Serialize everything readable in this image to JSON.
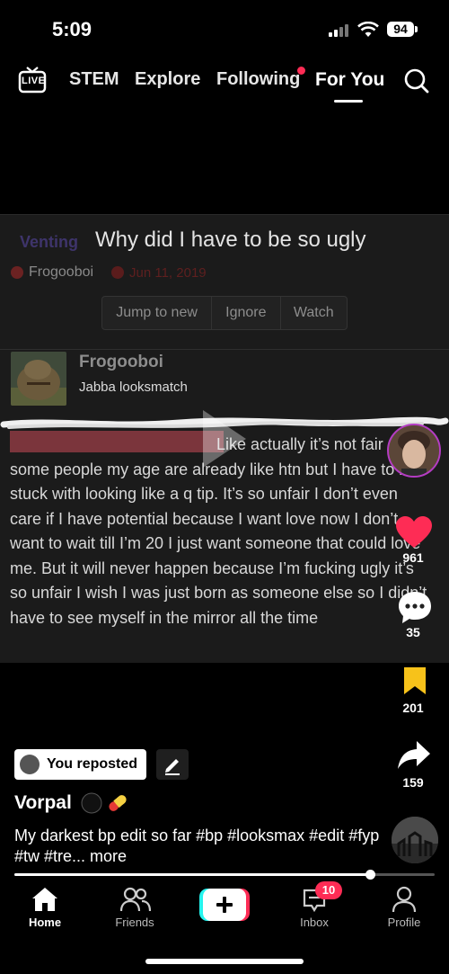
{
  "status_bar": {
    "time": "5:09",
    "battery": "94"
  },
  "top_nav": {
    "live_label": "LIVE",
    "tabs": [
      "STEM",
      "Explore",
      "Following",
      "For You"
    ],
    "active_tab": "For You"
  },
  "forum_post": {
    "category": "Venting",
    "thread_title": "Why did I have to be so ugly",
    "thread_author": "Frogooboi",
    "thread_date": "Jun 11, 2019",
    "buttons": [
      "Jump to new",
      "Ignore",
      "Watch"
    ],
    "post_author": "Frogooboi",
    "post_subtitle": "Jabba looksmatch",
    "body_first_line": "Like actually it’s not fair",
    "body_rest": "some people my age are already like htn but I have to be stuck with looking like a q tip. It’s so unfair I don’t even care if I have potential because I want love now I don’t want to wait till I’m 20 I just want someone that could love me. But it will never happen because I’m fucking ugly it’s so unfair I wish I was just born as someone else so I didn’t have to see myself in the mirror all the time"
  },
  "actions": {
    "likes": "961",
    "comments": "35",
    "saves": "201",
    "shares": "159"
  },
  "video_info": {
    "repost_label": "You reposted",
    "username": "Vorpal",
    "caption": "My darkest bp edit so far #bp #looksmax #edit #fyp #tw #tre... more",
    "progress": 0.846
  },
  "tab_bar": {
    "tabs": [
      "Home",
      "Friends",
      "",
      "Inbox",
      "Profile"
    ],
    "inbox_badge": "10",
    "active": "Home"
  },
  "colors": {
    "accent": "#fe2c55",
    "save": "#f7c21a",
    "create_cyan": "#25f4ee"
  }
}
